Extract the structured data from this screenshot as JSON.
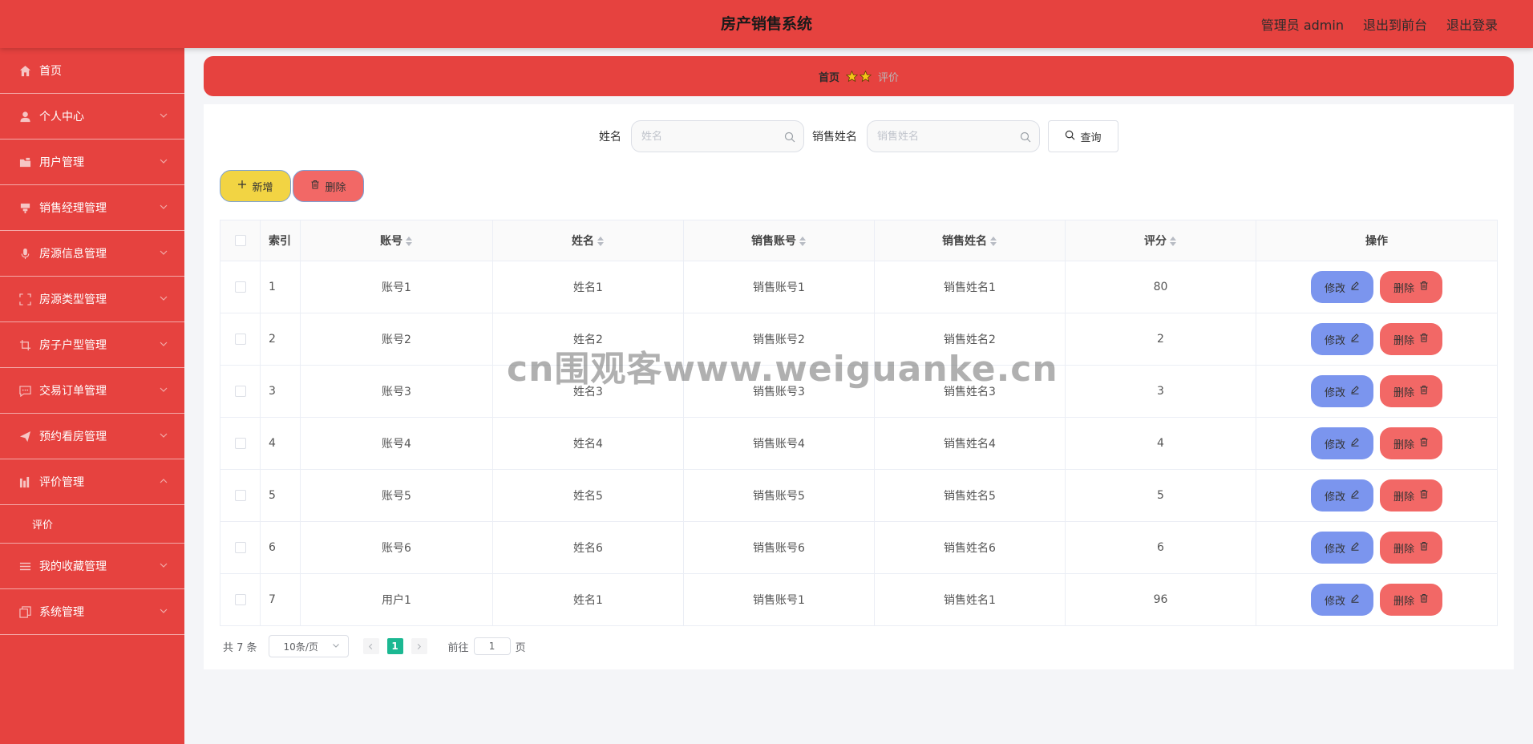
{
  "header": {
    "title": "房产销售系统",
    "user_label": "管理员 admin",
    "to_front_label": "退出到前台",
    "logout_label": "退出登录"
  },
  "sidebar": {
    "items": [
      {
        "label": "首页",
        "icon": "home-icon"
      },
      {
        "label": "个人中心",
        "icon": "user-icon"
      },
      {
        "label": "用户管理",
        "icon": "folder-icon"
      },
      {
        "label": "销售经理管理",
        "icon": "podium-icon"
      },
      {
        "label": "房源信息管理",
        "icon": "microphone-icon"
      },
      {
        "label": "房源类型管理",
        "icon": "fullscreen-icon"
      },
      {
        "label": "房子户型管理",
        "icon": "crop-icon"
      },
      {
        "label": "交易订单管理",
        "icon": "chat-icon"
      },
      {
        "label": "预约看房管理",
        "icon": "send-icon"
      },
      {
        "label": "评价管理",
        "icon": "chart-icon"
      },
      {
        "label": "我的收藏管理",
        "icon": "list-icon"
      },
      {
        "label": "系统管理",
        "icon": "copy-icon"
      }
    ],
    "sub_item": "评价"
  },
  "breadcrumb": {
    "home": "首页",
    "current": "评价"
  },
  "search": {
    "name_label": "姓名",
    "name_placeholder": "姓名",
    "sales_name_label": "销售姓名",
    "sales_name_placeholder": "销售姓名",
    "query_label": "查询"
  },
  "actions": {
    "add_label": "新增",
    "delete_label": "删除"
  },
  "table": {
    "headers": {
      "index": "索引",
      "account": "账号",
      "name": "姓名",
      "sales_account": "销售账号",
      "sales_name": "销售姓名",
      "score": "评分",
      "ops": "操作"
    },
    "edit_label": "修改",
    "delete_label": "删除",
    "rows": [
      {
        "index": "1",
        "account": "账号1",
        "name": "姓名1",
        "sales_account": "销售账号1",
        "sales_name": "销售姓名1",
        "score": "80"
      },
      {
        "index": "2",
        "account": "账号2",
        "name": "姓名2",
        "sales_account": "销售账号2",
        "sales_name": "销售姓名2",
        "score": "2"
      },
      {
        "index": "3",
        "account": "账号3",
        "name": "姓名3",
        "sales_account": "销售账号3",
        "sales_name": "销售姓名3",
        "score": "3"
      },
      {
        "index": "4",
        "account": "账号4",
        "name": "姓名4",
        "sales_account": "销售账号4",
        "sales_name": "销售姓名4",
        "score": "4"
      },
      {
        "index": "5",
        "account": "账号5",
        "name": "姓名5",
        "sales_account": "销售账号5",
        "sales_name": "销售姓名5",
        "score": "5"
      },
      {
        "index": "6",
        "account": "账号6",
        "name": "姓名6",
        "sales_account": "销售账号6",
        "sales_name": "销售姓名6",
        "score": "6"
      },
      {
        "index": "7",
        "account": "用户1",
        "name": "姓名1",
        "sales_account": "销售账号1",
        "sales_name": "销售姓名1",
        "score": "96"
      }
    ]
  },
  "pagination": {
    "total": "共 7 条",
    "page_size": "10条/页",
    "current_page": "1",
    "goto_label": "前往",
    "goto_value": "1",
    "page_suffix": "页"
  },
  "watermark": "cn围观客www.weiguanke.cn",
  "colors": {
    "primary": "#e6423f",
    "add_button": "#f2d443",
    "delete_button": "#f26866",
    "edit_button": "#7b95ee",
    "page_active": "#1bb892"
  }
}
